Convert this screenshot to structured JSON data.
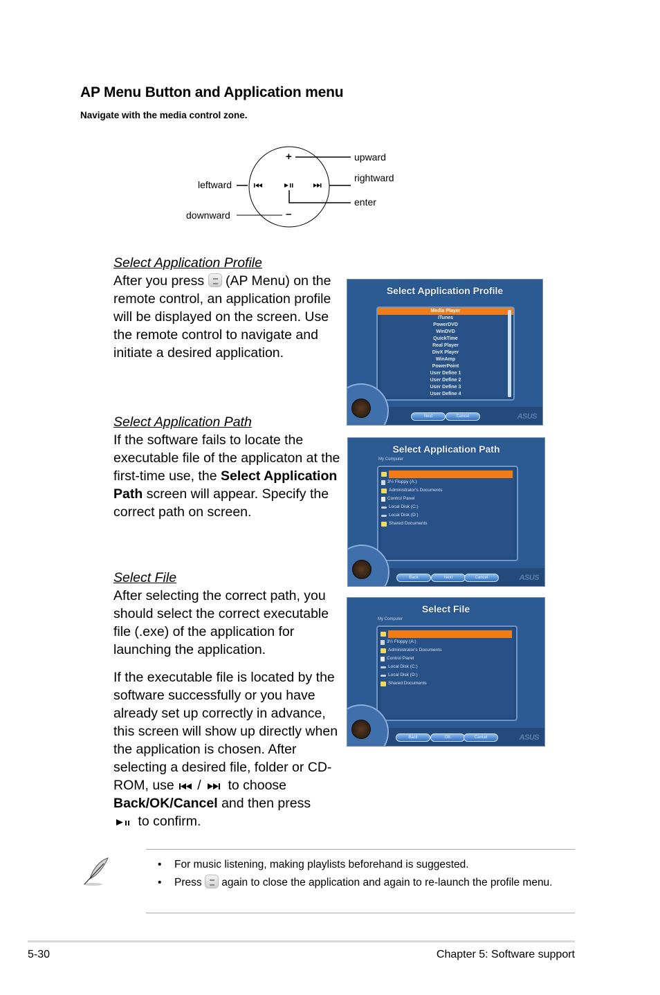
{
  "header": {
    "title": "AP Menu Button and Application menu",
    "subtitle": "Navigate with the media control zone."
  },
  "diagram": {
    "labels": {
      "upward": "upward",
      "rightward": "rightward",
      "enter": "enter",
      "leftward": "leftward",
      "downward": "downward"
    },
    "symbols": {
      "plus": "+",
      "minus": "–"
    }
  },
  "sections": [
    {
      "heading": "Select Application Profile",
      "text_before_icon": "After you press",
      "text_after_icon": "(AP Menu) on the remote control, an application profile will be displayed on the screen. Use the remote control to navigate and initiate a desired application."
    },
    {
      "heading": "Select Application Path",
      "text_1": "If the software fails to locate the executable file of the applicaton at the first-time use, the",
      "bold": "Select Application Path",
      "text_2": "screen will appear. Specify the correct path on screen."
    },
    {
      "heading": "Select File",
      "para1": "After selecting the correct path, you should select the correct executable file (.exe) of the application for launching the application.",
      "para2": "If the executable file is located by the software successfully or you have already set up correctly in advance, this screen will show up directly when the application is chosen. After selecting a desired file, folder or CD-ROM, use",
      "slash": "/",
      "to_choose": "to choose",
      "bold": "Back/OK/Cancel",
      "then_press": "and then press",
      "to_confirm": "to confirm."
    }
  ],
  "screens": {
    "profile": {
      "title": "Select Application Profile",
      "items": [
        "Media Player",
        "iTunes",
        "PowerDVD",
        "WinDVD",
        "QuickTime",
        "Real Player",
        "DivX Player",
        "WinAmp",
        "PowerPoint",
        "User Define 1",
        "User Define 2",
        "User Define 3",
        "User Define 4"
      ],
      "selected_index": 0,
      "buttons": [
        "Next",
        "Cancel"
      ],
      "brand": "ASUS"
    },
    "path": {
      "title": "Select Application Path",
      "location": "My Computer",
      "items": [
        {
          "icon": "folder",
          "label": ""
        },
        {
          "icon": "floppy",
          "label": "3½ Floppy (A:)"
        },
        {
          "icon": "folder",
          "label": "Administrator's Documents"
        },
        {
          "icon": "panel",
          "label": "Control Panel"
        },
        {
          "icon": "disk",
          "label": "Local Disk (C:)"
        },
        {
          "icon": "disk",
          "label": "Local Disk (D:)"
        },
        {
          "icon": "folder",
          "label": "Shared Documents"
        }
      ],
      "buttons": [
        "Back",
        "Next",
        "Cancel"
      ],
      "brand": "ASUS"
    },
    "file": {
      "title": "Select File",
      "location": "My Computer",
      "items": [
        {
          "icon": "folder",
          "label": ""
        },
        {
          "icon": "floppy",
          "label": "3½ Floppy (A:)"
        },
        {
          "icon": "folder",
          "label": "Administrator's Documents"
        },
        {
          "icon": "panel",
          "label": "Control Panel"
        },
        {
          "icon": "disk",
          "label": "Local Disk (C:)"
        },
        {
          "icon": "disk",
          "label": "Local Disk (D:)"
        },
        {
          "icon": "folder",
          "label": "Shared Documents"
        }
      ],
      "buttons": [
        "Back",
        "OK",
        "Cancel"
      ],
      "brand": "ASUS"
    }
  },
  "note": {
    "bullet": "•",
    "items": [
      {
        "text": "For music listening, making playlists beforehand is suggested."
      },
      {
        "before_icon": "Press",
        "after_icon": "again to close the application and again to re-launch the profile menu."
      }
    ]
  },
  "footer": {
    "page_number": "5-30",
    "chapter": "Chapter 5: Software support"
  }
}
